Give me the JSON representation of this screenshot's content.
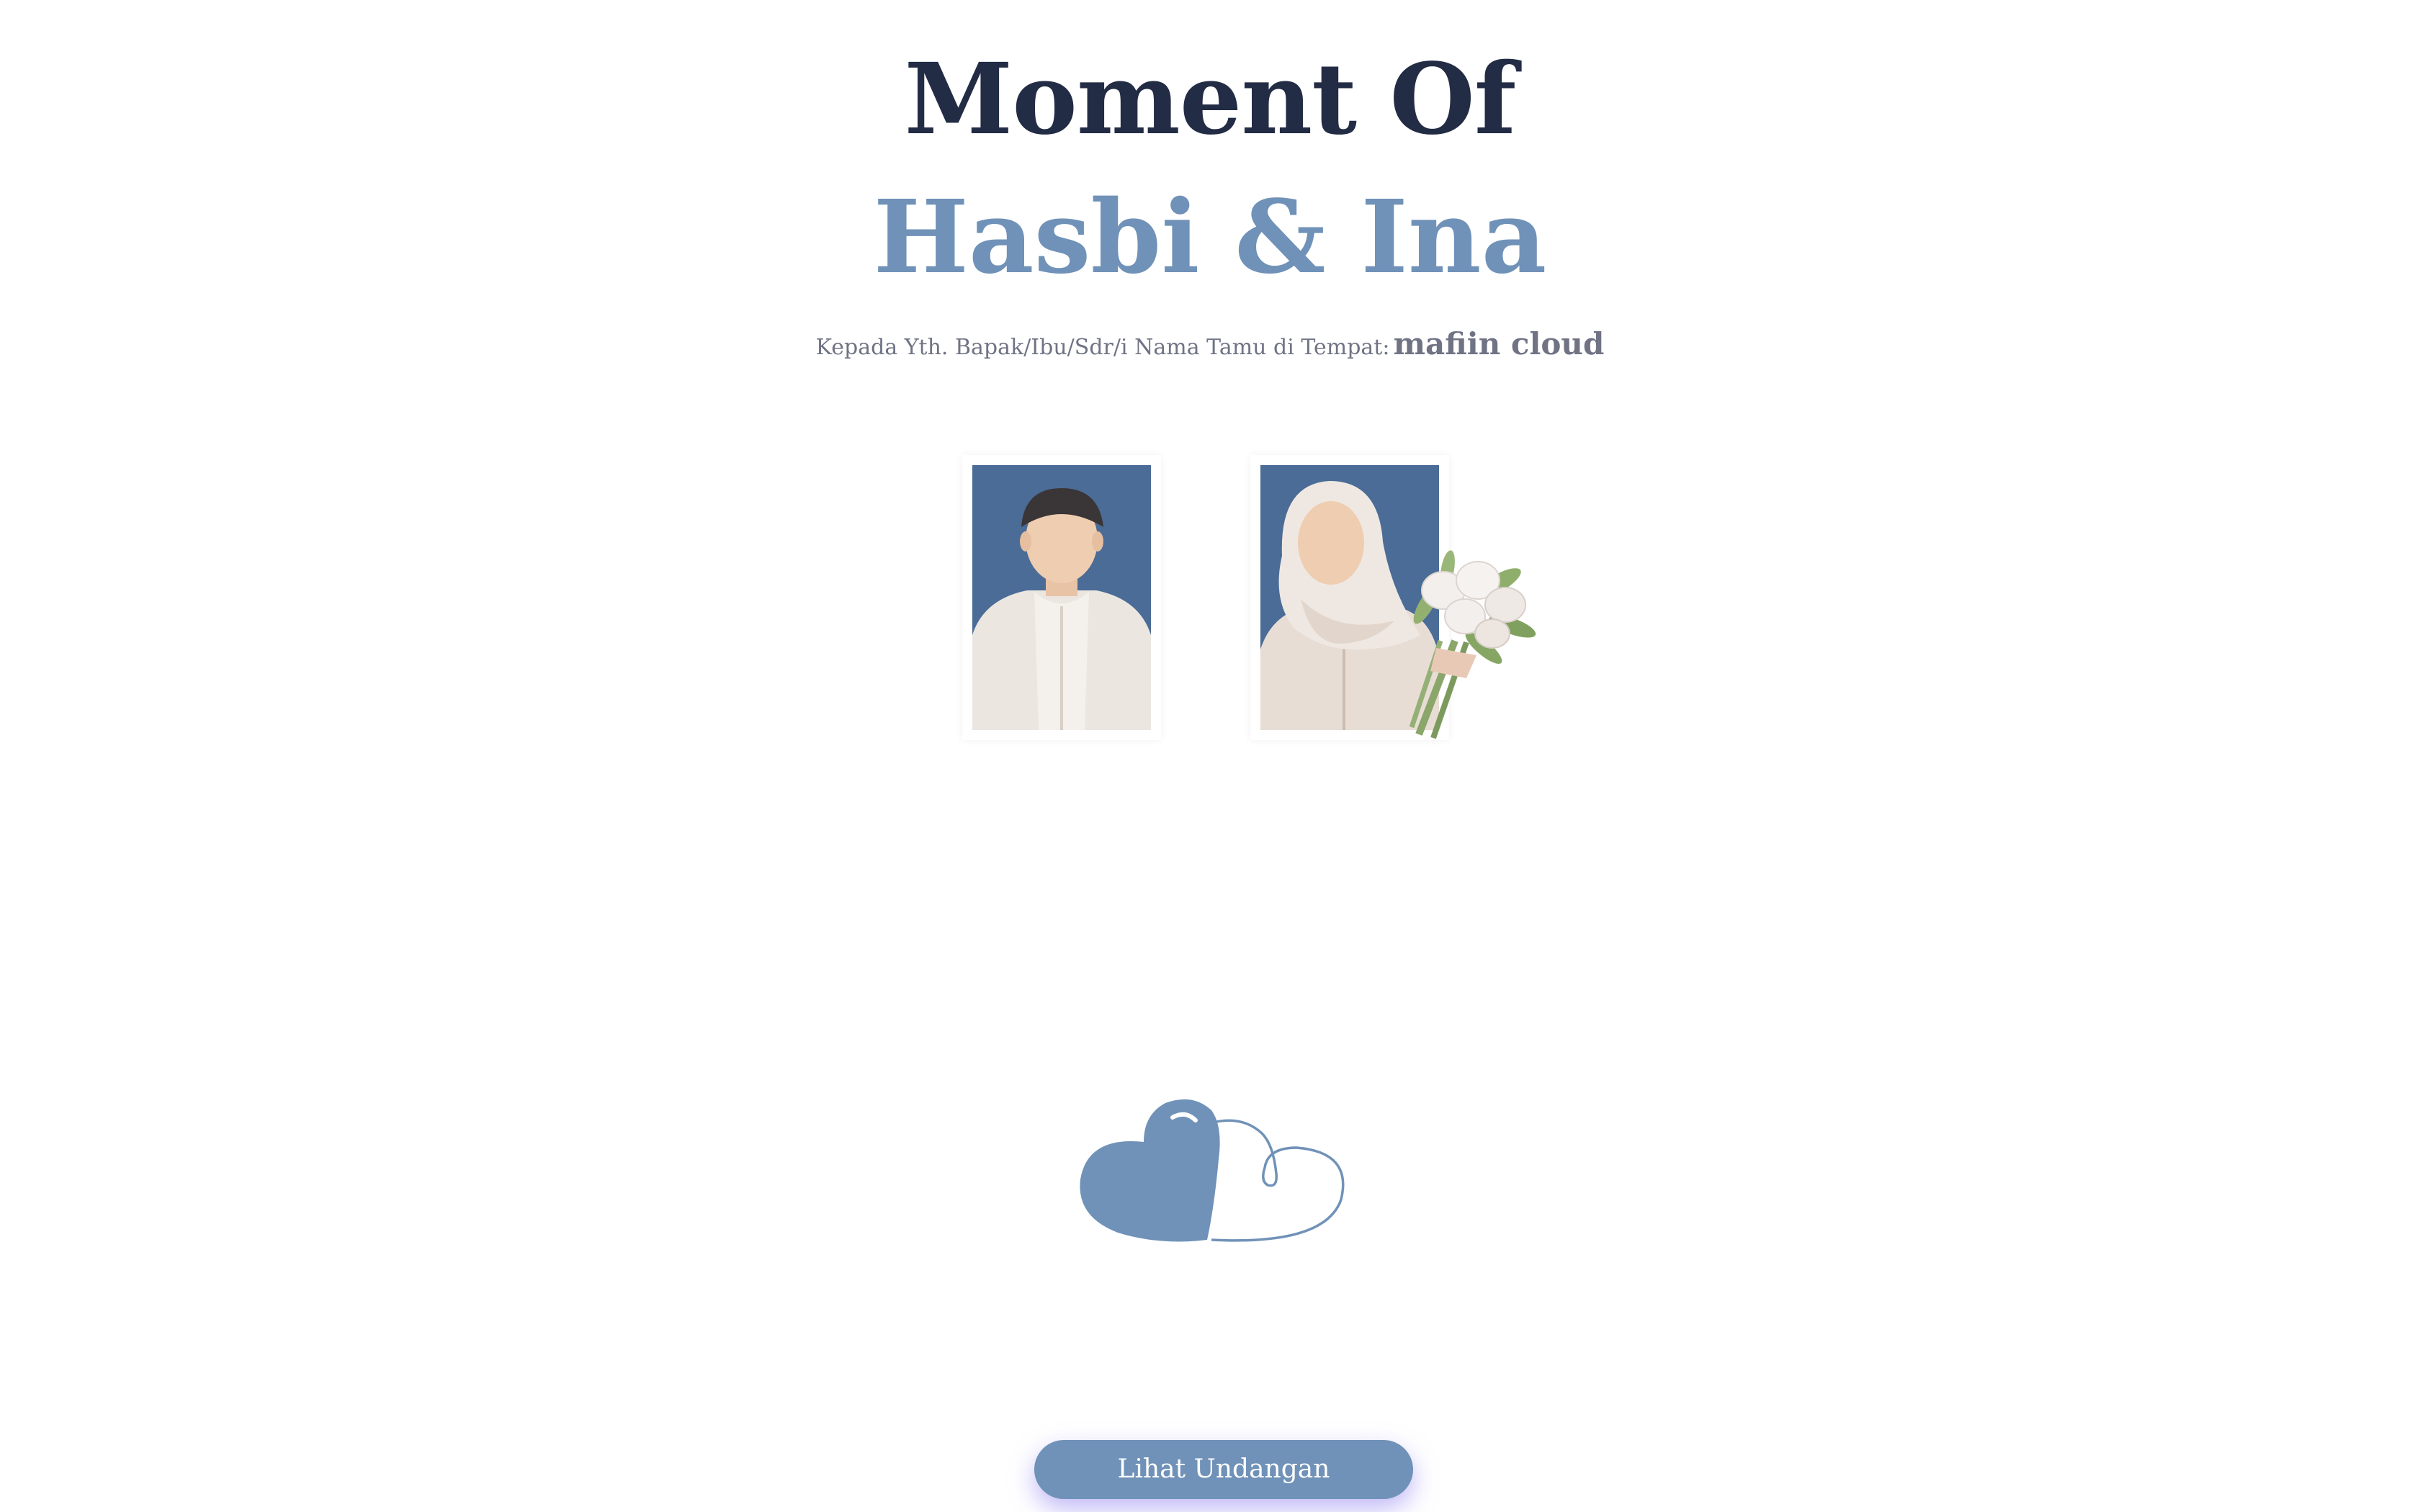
{
  "header": {
    "title_top": "Moment Of",
    "title_names": "Hasbi & Ina"
  },
  "guest": {
    "prefix": "Kepada Yth. Bapak/Ibu/Sdr/i Nama Tamu di Tempat:",
    "name": "mafiin cloud"
  },
  "photos": {
    "groom_icon": "groom-illustration",
    "bride_icon": "bride-illustration",
    "bouquet_icon": "bouquet-illustration"
  },
  "decoration": {
    "hearts_icon": "double-heart-icon"
  },
  "cta": {
    "label": "Lihat Undangan"
  },
  "colors": {
    "title_dark": "#232c45",
    "accent_blue": "#7092b8",
    "photo_bg": "#4a6c96",
    "text_gray": "#6f7384",
    "button_glow": "#8e80ee"
  }
}
